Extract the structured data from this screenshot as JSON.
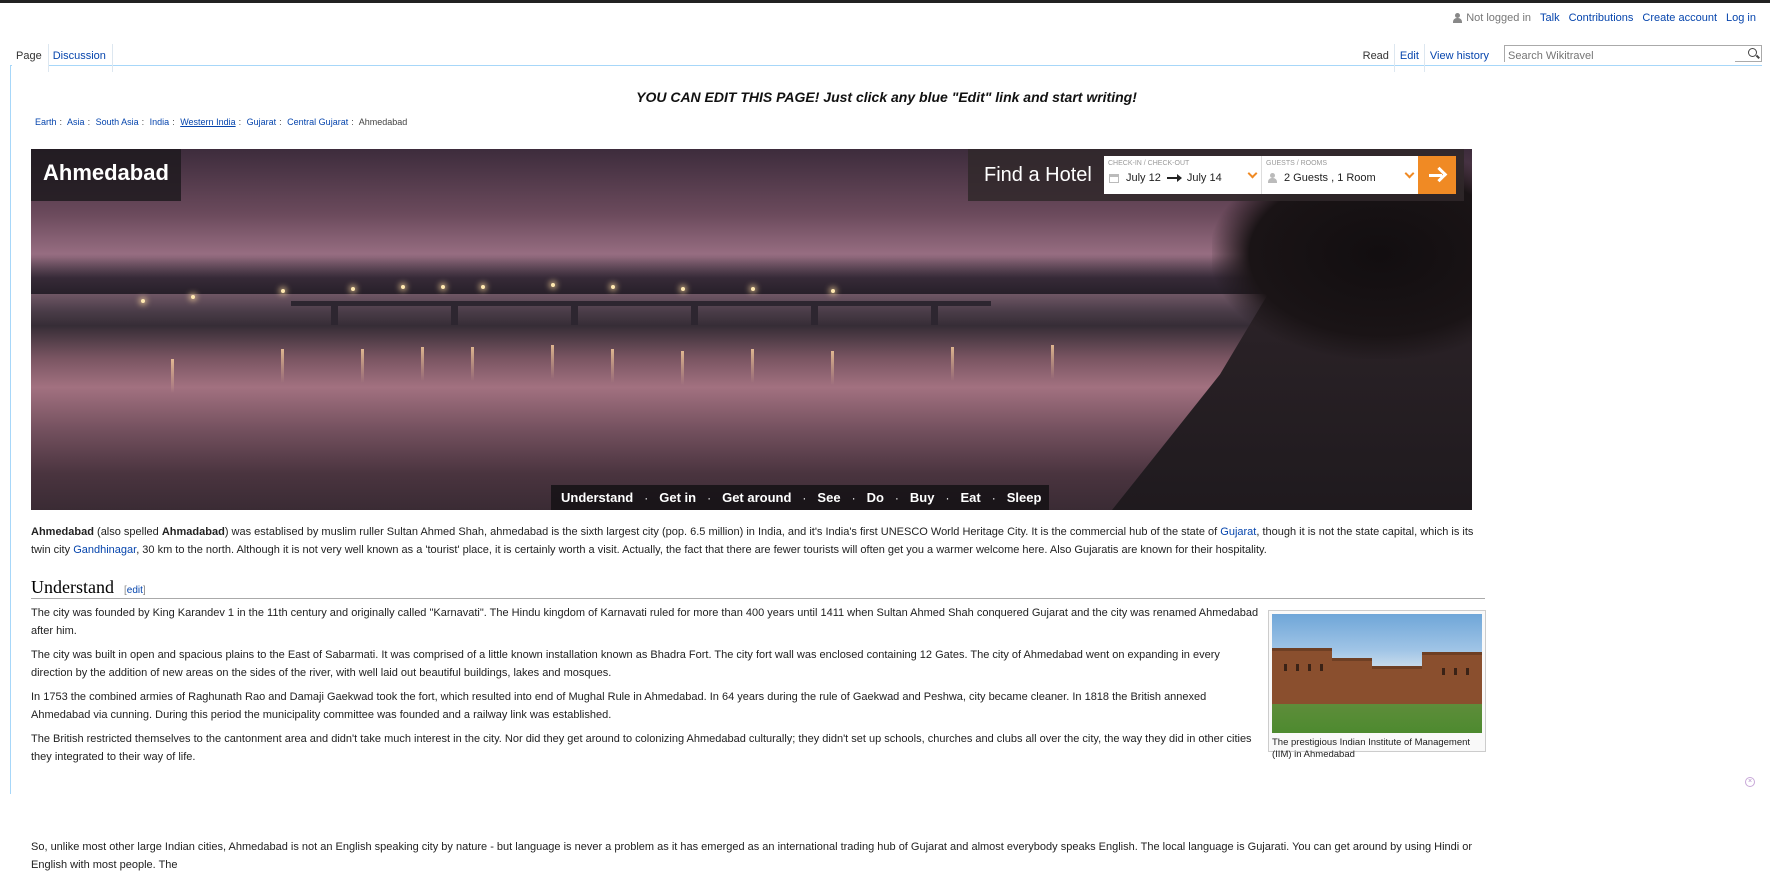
{
  "personal": {
    "not_logged_in": "Not logged in",
    "links": [
      "Talk",
      "Contributions",
      "Create account",
      "Log in"
    ]
  },
  "tabs_left": [
    "Page",
    "Discussion"
  ],
  "tabs_right": [
    "Read",
    "Edit",
    "View history"
  ],
  "search": {
    "placeholder": "Search Wikitravel"
  },
  "sitenotice": "YOU CAN EDIT THIS PAGE! Just click any blue \"Edit\" link and start writing!",
  "breadcrumbs": [
    "Earth",
    "Asia",
    "South Asia",
    "India",
    "Western India",
    "Gujarat",
    "Central Gujarat",
    "Ahmedabad"
  ],
  "banner": {
    "title": "Ahmedabad",
    "hotel": {
      "label": "Find a Hotel",
      "checkin_caption": "CHECK-IN / CHECK-OUT",
      "checkin": "July 12",
      "checkout": "July 14",
      "guests_caption": "GUESTS / ROOMS",
      "guests": "2 Guests , 1 Room",
      "accent": "#f08a24"
    },
    "quicknav": [
      "Understand",
      "Get in",
      "Get around",
      "See",
      "Do",
      "Buy",
      "Eat",
      "Sleep"
    ]
  },
  "lead": {
    "b1": "Ahmedabad",
    "t1": " (also spelled ",
    "b2": "Ahmadabad",
    "t2": ") was establised by muslim ruller Sultan Ahmed Shah, ahmedabad is the sixth largest city (pop. 6.5 million) in India, and it's India's first UNESCO World Heritage City. It is the commercial hub of the state of ",
    "l1": "Gujarat",
    "t3": ", though it is not the state capital, which is its twin city ",
    "l2": "Gandhinagar",
    "t4": ", 30 km to the north. Although it is not very well known as a 'tourist' place, it is certainly worth a visit. Actually, the fact that there are fewer tourists will often get you a warmer welcome here. Also Gujaratis are known for their hospitality."
  },
  "understand": {
    "heading": "Understand",
    "edit": "edit",
    "paragraphs": [
      "The city was founded by King Karandev 1 in the 11th century and originally called \"Karnavati\". The Hindu kingdom of Karnavati ruled for more than 400 years until 1411 when Sultan Ahmed Shah conquered Gujarat and the city was renamed Ahmedabad after him.",
      "The city was built in open and spacious plains to the East of Sabarmati. It was comprised of a little known installation known as Bhadra Fort. The city fort wall was enclosed containing 12 Gates. The city of Ahmedabad went on expanding in every direction by the addition of new areas on the sides of the river, with well laid out beautiful buildings, lakes and mosques.",
      "In 1753 the combined armies of Raghunath Rao and Damaji Gaekwad took the fort, which resulted into end of Mughal Rule in Ahmedabad. In 64 years during the rule of Gaekwad and Peshwa, city became cleaner. In 1818 the British annexed Ahmedabad via cunning. During this period the municipality committee was founded and a railway link was established.",
      "The British restricted themselves to the cantonment area and didn't take much interest in the city. Nor did they get around to colonizing Ahmedabad culturally; they didn't set up schools, churches and clubs all over the city, the way they did in other cities they integrated to their way of life."
    ],
    "last_paragraph": "So, unlike most other large Indian cities, Ahmedabad is not an English speaking city by nature - but language is never a problem as it has emerged as an international trading hub of Gujarat and almost everybody speaks English. The local language is Gujarati. You can get around by using Hindi or English with most people. The",
    "thumb_caption": "The prestigious Indian Institute of Management (IIM) in Ahmedabad"
  }
}
